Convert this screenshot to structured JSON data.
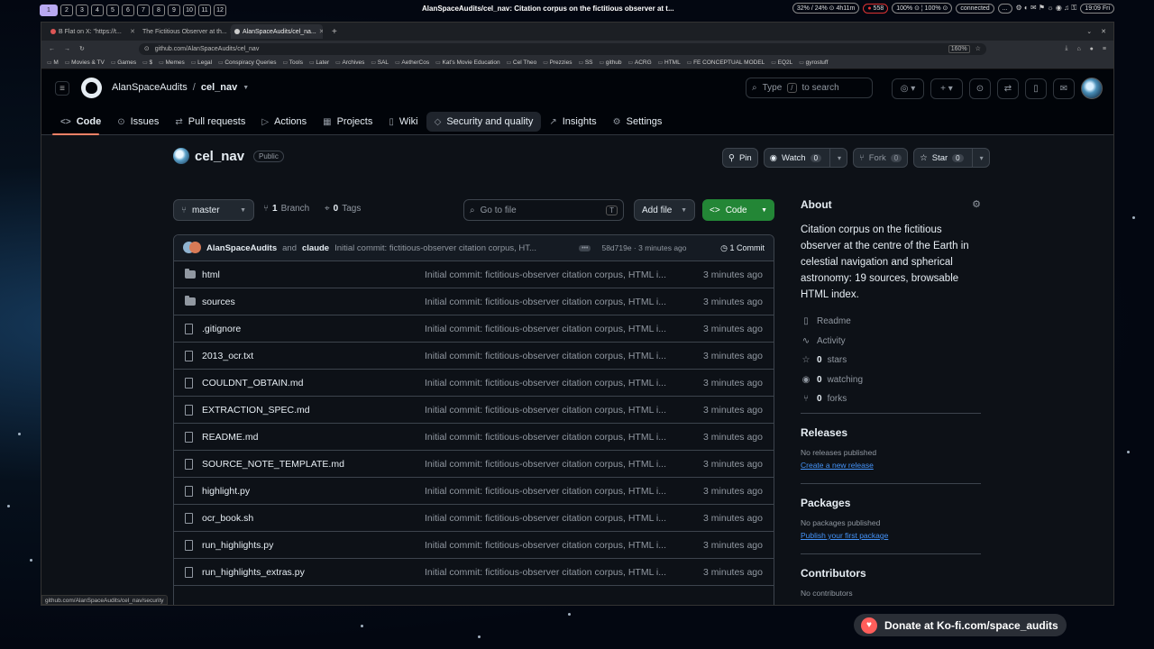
{
  "system": {
    "workspaces": [
      "1",
      "2",
      "3",
      "4",
      "5",
      "6",
      "7",
      "8",
      "9",
      "10",
      "11",
      "12"
    ],
    "window_title": "AlanSpaceAudits/cel_nav: Citation corpus on the fictitious observer at t...",
    "status_pills": [
      "32% / 24% ⊙ 4h11m",
      "558",
      "100% ⊙ ¦ 100% ⊙",
      "connected",
      "..."
    ],
    "clock": "19:09 Fri"
  },
  "browser": {
    "tabs": [
      {
        "label": "B Flat on X: \"https://t..."
      },
      {
        "label": "The Fictitious Observer at th..."
      },
      {
        "label": "AlanSpaceAudits/cel_na..."
      }
    ],
    "url": "github.com/AlanSpaceAudits/cel_nav",
    "zoom": "160%",
    "bookmarks": [
      "M",
      "Movies & TV",
      "Games",
      "$",
      "Memes",
      "Legal",
      "Conspiracy Queries",
      "Tools",
      "Later",
      "Archives",
      "SAL",
      "AetherCos",
      "Kat's Movie Education",
      "Cel Theo",
      "Prezzies",
      "SS",
      "github",
      "ACRG",
      "HTML",
      "FE CONCEPTUAL MODEL",
      "EQ2L",
      "gyrostuff"
    ],
    "status_url": "github.com/AlanSpaceAudits/cel_nav/security"
  },
  "header": {
    "owner": "AlanSpaceAudits",
    "repo": "cel_nav",
    "search_prefix": "Type",
    "search_key": "/",
    "search_suffix": "to search"
  },
  "nav": {
    "tabs": [
      {
        "label": "Code",
        "icon": "<>"
      },
      {
        "label": "Issues",
        "icon": "⊙"
      },
      {
        "label": "Pull requests",
        "icon": "⇄"
      },
      {
        "label": "Actions",
        "icon": "▷"
      },
      {
        "label": "Projects",
        "icon": "▦"
      },
      {
        "label": "Wiki",
        "icon": "▯"
      },
      {
        "label": "Security and quality",
        "icon": "◇"
      },
      {
        "label": "Insights",
        "icon": "↗"
      },
      {
        "label": "Settings",
        "icon": "⚙"
      }
    ]
  },
  "repo": {
    "name": "cel_nav",
    "visibility": "Public",
    "pin_label": "Pin",
    "watch_label": "Watch",
    "watch_count": "0",
    "fork_label": "Fork",
    "fork_count": "0",
    "star_label": "Star",
    "star_count": "0"
  },
  "toolbar": {
    "branch": "master",
    "branch_count": "1",
    "branch_label": "Branch",
    "tag_count": "0",
    "tag_label": "Tags",
    "goto_placeholder": "Go to file",
    "goto_key": "T",
    "add_file": "Add file",
    "code": "Code"
  },
  "commit": {
    "author1": "AlanSpaceAudits",
    "and": "and",
    "author2": "claude",
    "message": "Initial commit: fictitious-observer citation corpus, HT...",
    "hash_time": "58d719e · 3 minutes ago",
    "count": "1 Commit"
  },
  "files": [
    {
      "name": "html",
      "type": "folder",
      "msg": "Initial commit: fictitious-observer citation corpus, HTML i...",
      "time": "3 minutes ago"
    },
    {
      "name": "sources",
      "type": "folder",
      "msg": "Initial commit: fictitious-observer citation corpus, HTML i...",
      "time": "3 minutes ago"
    },
    {
      "name": ".gitignore",
      "type": "file",
      "msg": "Initial commit: fictitious-observer citation corpus, HTML i...",
      "time": "3 minutes ago"
    },
    {
      "name": "2013_ocr.txt",
      "type": "file",
      "msg": "Initial commit: fictitious-observer citation corpus, HTML i...",
      "time": "3 minutes ago"
    },
    {
      "name": "COULDNT_OBTAIN.md",
      "type": "file",
      "msg": "Initial commit: fictitious-observer citation corpus, HTML i...",
      "time": "3 minutes ago"
    },
    {
      "name": "EXTRACTION_SPEC.md",
      "type": "file",
      "msg": "Initial commit: fictitious-observer citation corpus, HTML i...",
      "time": "3 minutes ago"
    },
    {
      "name": "README.md",
      "type": "file",
      "msg": "Initial commit: fictitious-observer citation corpus, HTML i...",
      "time": "3 minutes ago"
    },
    {
      "name": "SOURCE_NOTE_TEMPLATE.md",
      "type": "file",
      "msg": "Initial commit: fictitious-observer citation corpus, HTML i...",
      "time": "3 minutes ago"
    },
    {
      "name": "highlight.py",
      "type": "file",
      "msg": "Initial commit: fictitious-observer citation corpus, HTML i...",
      "time": "3 minutes ago"
    },
    {
      "name": "ocr_book.sh",
      "type": "file",
      "msg": "Initial commit: fictitious-observer citation corpus, HTML i...",
      "time": "3 minutes ago"
    },
    {
      "name": "run_highlights.py",
      "type": "file",
      "msg": "Initial commit: fictitious-observer citation corpus, HTML i...",
      "time": "3 minutes ago"
    },
    {
      "name": "run_highlights_extras.py",
      "type": "file",
      "msg": "Initial commit: fictitious-observer citation corpus, HTML i...",
      "time": "3 minutes ago"
    }
  ],
  "about": {
    "title": "About",
    "description": "Citation corpus on the fictitious observer at the centre of the Earth in celestial navigation and spherical astronomy: 19 sources, browsable HTML index.",
    "readme": "Readme",
    "activity": "Activity",
    "stars": "0",
    "stars_label": "stars",
    "watching": "0",
    "watching_label": "watching",
    "forks": "0",
    "forks_label": "forks"
  },
  "releases": {
    "title": "Releases",
    "empty": "No releases published",
    "link": "Create a new release"
  },
  "packages": {
    "title": "Packages",
    "empty": "No packages published",
    "link": "Publish your first package"
  },
  "contributors": {
    "title": "Contributors",
    "empty": "No contributors"
  },
  "overlay": {
    "kofi": "Donate at Ko-fi.com/space_audits"
  },
  "colors": {
    "accent_green": "#238636",
    "underline": "#f78166",
    "link": "#4493f8",
    "bg": "#0d1117"
  }
}
